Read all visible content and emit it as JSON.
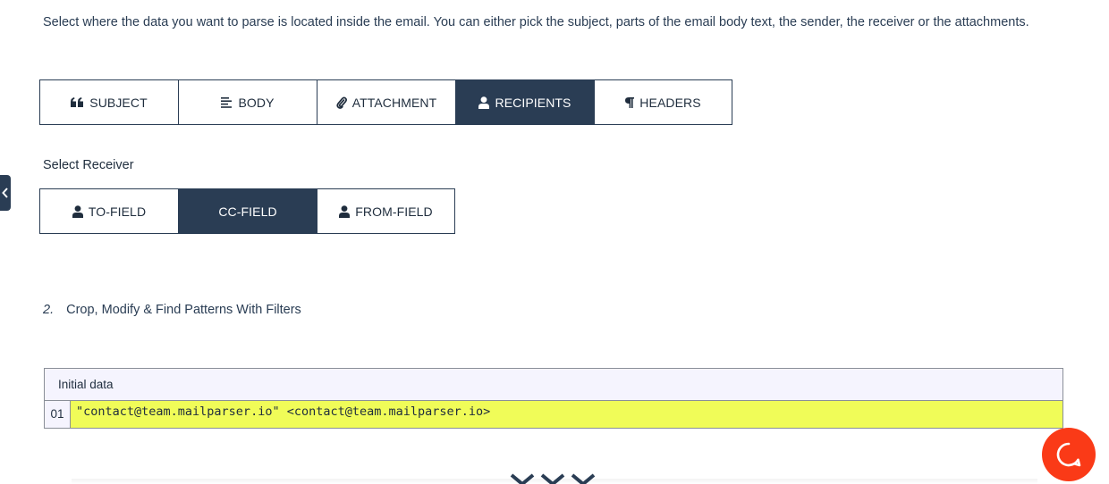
{
  "intro_text": "Select where the data you want to parse is located inside the email. You can either pick the subject, parts of the email body text, the sender, the receiver or the attachments.",
  "source_tabs": [
    {
      "label": "SUBJECT",
      "icon": "quote-icon",
      "active": false
    },
    {
      "label": "BODY",
      "icon": "align-left-icon",
      "active": false
    },
    {
      "label": "ATTACHMENT",
      "icon": "paperclip-icon",
      "active": false
    },
    {
      "label": "RECIPIENTS",
      "icon": "user-icon",
      "active": true
    },
    {
      "label": "HEADERS",
      "icon": "paragraph-icon",
      "active": false
    }
  ],
  "receiver": {
    "label": "Select Receiver",
    "options": [
      {
        "label": "TO-FIELD",
        "icon": "user-icon",
        "active": false
      },
      {
        "label": "CC-FIELD",
        "icon": "user-icon",
        "active": true
      },
      {
        "label": "FROM-FIELD",
        "icon": "user-icon",
        "active": false
      }
    ]
  },
  "step": {
    "number": "2.",
    "title": "Crop, Modify & Find Patterns With Filters"
  },
  "initial_data": {
    "header": "Initial data",
    "rows": [
      {
        "line": "01",
        "value": "\"contact@team.mailparser.io\" <contact@team.mailparser.io>"
      }
    ]
  },
  "colors": {
    "accent": "#2a3d54",
    "highlight": "#f0fc58",
    "help_button": "#fa3a17",
    "data_header_bg": "#f5f4fe"
  }
}
